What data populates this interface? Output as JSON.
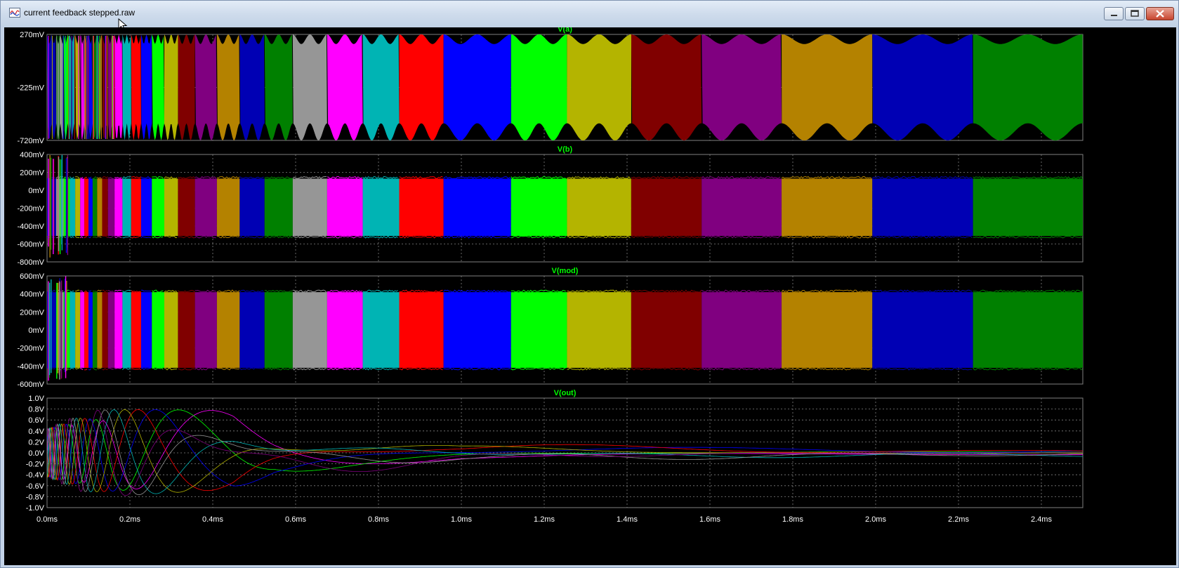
{
  "window": {
    "title": "current feedback stepped.raw"
  },
  "icons": {
    "app": "waveform-icon",
    "minimize": "minimize-icon",
    "maximize": "maximize-icon",
    "close": "close-icon",
    "cursor": "mouse-pointer-icon"
  },
  "colors": {
    "background": "#000000",
    "grid": "#808080",
    "trace_title": "#00ff00",
    "labels": "#ffffff",
    "step_palette": [
      "#ff00ff",
      "#00b4b4",
      "#ff0000",
      "#0000ff",
      "#00ff00",
      "#b4b400",
      "#800000",
      "#800080",
      "#b48200",
      "#0000b4",
      "#008000",
      "#969696"
    ]
  },
  "chart_data": [
    {
      "type": "line",
      "title": "V(a)",
      "ylim": [
        -720,
        270
      ],
      "yunit": "mV",
      "yticks": [
        "270mV",
        "-225mV",
        "-720mV"
      ],
      "envelope": {
        "ripple_top": [
          180,
          270
        ],
        "ripple_bottom": [
          -720,
          -560
        ]
      }
    },
    {
      "type": "line",
      "title": "V(b)",
      "ylim": [
        -800,
        400
      ],
      "yunit": "mV",
      "yticks": [
        "400mV",
        "200mV",
        "0mV",
        "-200mV",
        "-400mV",
        "-600mV",
        "-800mV"
      ],
      "envelope": {
        "high": 130,
        "low": -510
      }
    },
    {
      "type": "line",
      "title": "V(mod)",
      "ylim": [
        -600,
        600
      ],
      "yunit": "mV",
      "yticks": [
        "600mV",
        "400mV",
        "200mV",
        "0mV",
        "-200mV",
        "-400mV",
        "-600mV"
      ],
      "envelope": {
        "high": 420,
        "low": -420
      }
    },
    {
      "type": "line",
      "title": "V(out)",
      "ylim": [
        -1.0,
        1.0
      ],
      "yunit": "V",
      "yticks": [
        "1.0V",
        "0.8V",
        "0.6V",
        "0.4V",
        "0.2V",
        "0.0V",
        "-0.2V",
        "-0.4V",
        "-0.6V",
        "-0.8V",
        "-1.0V"
      ],
      "amplitude_profile": [
        [
          0.0,
          0.8
        ],
        [
          0.45,
          0.8
        ],
        [
          0.55,
          0.5
        ],
        [
          1.0,
          0.18
        ],
        [
          1.6,
          0.12
        ],
        [
          2.2,
          0.07
        ],
        [
          2.5,
          0.07
        ]
      ]
    }
  ],
  "x_axis": {
    "range_ms": [
      0,
      2.5
    ],
    "ticks": [
      "0.0ms",
      "0.2ms",
      "0.4ms",
      "0.6ms",
      "0.8ms",
      "1.0ms",
      "1.2ms",
      "1.4ms",
      "1.6ms",
      "1.8ms",
      "2.0ms",
      "2.2ms",
      "2.4ms"
    ],
    "grid": true
  },
  "steps": {
    "boundaries_ms": [
      0.0,
      0.022,
      0.04,
      0.055,
      0.068,
      0.08,
      0.09,
      0.1,
      0.11,
      0.121,
      0.133,
      0.147,
      0.163,
      0.182,
      0.203,
      0.227,
      0.253,
      0.283,
      0.316,
      0.357,
      0.41,
      0.465,
      0.525,
      0.593,
      0.676,
      0.762,
      0.85,
      0.957,
      1.12,
      1.255,
      1.41,
      1.58,
      1.773,
      1.992,
      2.235,
      2.5
    ],
    "color_index": [
      9,
      11,
      4,
      1,
      5,
      0,
      2,
      3,
      10,
      8,
      6,
      7,
      0,
      1,
      2,
      3,
      4,
      5,
      6,
      7,
      8,
      9,
      10,
      11,
      0,
      1,
      2,
      3,
      4,
      5,
      6,
      7,
      8,
      9,
      10
    ]
  }
}
